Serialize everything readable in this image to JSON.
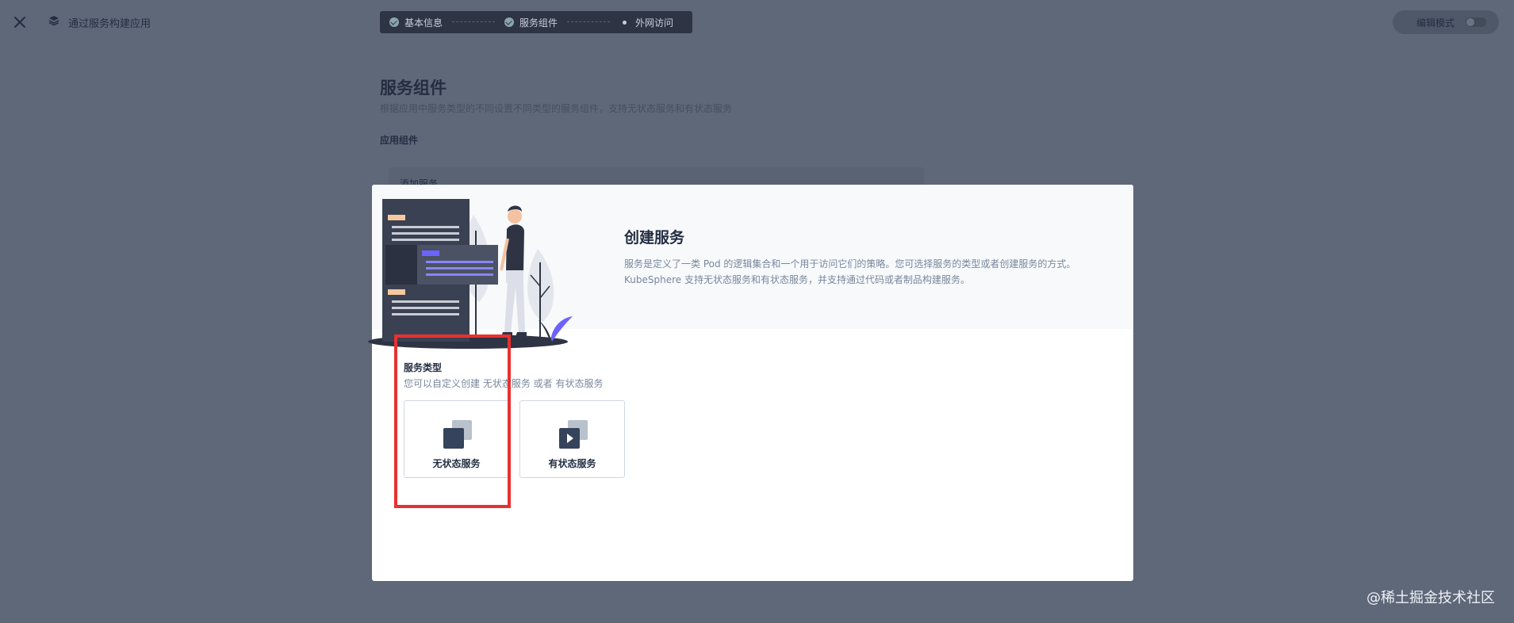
{
  "topbar": {
    "app_title": "通过服务构建应用",
    "steps": [
      {
        "label": "基本信息",
        "state": "done"
      },
      {
        "label": "服务组件",
        "state": "done"
      },
      {
        "label": "外网访问",
        "state": "pending"
      }
    ],
    "edit_mode_label": "编辑模式"
  },
  "background": {
    "section_title": "服务组件",
    "section_desc": "根据应用中服务类型的不同设置不同类型的服务组件，支持无状态服务和有状态服务",
    "components_label": "应用组件",
    "add_service_label": "添加服务"
  },
  "modal": {
    "title": "创建服务",
    "desc_line1": "服务是定义了一类 Pod 的逻辑集合和一个用于访问它们的策略。您可选择服务的类型或者创建服务的方式。",
    "desc_line2": "KubeSphere 支持无状态服务和有状态服务，并支持通过代码或者制品构建服务。",
    "service_type_label": "服务类型",
    "service_type_hint": "您可以自定义创建 无状态服务 或者 有状态服务",
    "cards": [
      {
        "label": "无状态服务",
        "icon": "stateless-icon"
      },
      {
        "label": "有状态服务",
        "icon": "stateful-play-icon"
      }
    ]
  },
  "colors": {
    "overlay": "#5f6879",
    "dark": "#242e42",
    "highlight": "#e8312f",
    "accent": "#5e58d6"
  },
  "watermark": "@稀土掘金技术社区"
}
